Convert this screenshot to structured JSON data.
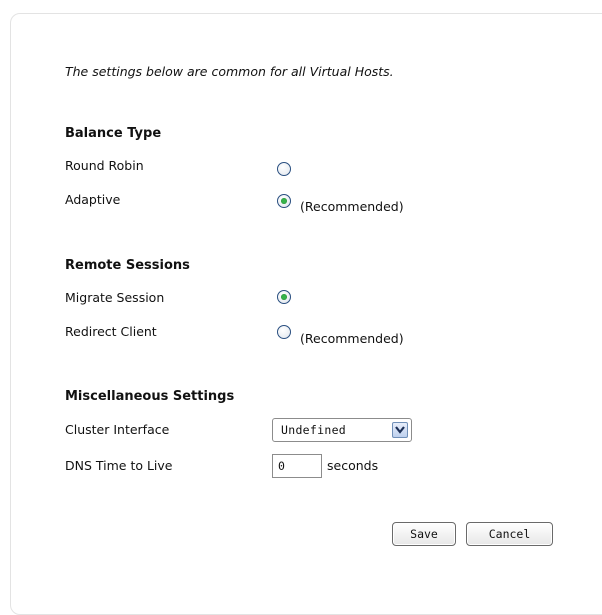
{
  "intro": "The settings below are common for all Virtual Hosts.",
  "balance_type": {
    "title": "Balance Type",
    "options": [
      {
        "label": "Round Robin",
        "checked": false,
        "note": ""
      },
      {
        "label": "Adaptive",
        "checked": true,
        "note": "(Recommended)"
      }
    ]
  },
  "remote_sessions": {
    "title": "Remote Sessions",
    "options": [
      {
        "label": "Migrate Session",
        "checked": true,
        "note": ""
      },
      {
        "label": "Redirect Client",
        "checked": false,
        "note": "(Recommended)"
      }
    ]
  },
  "misc": {
    "title": "Miscellaneous Settings",
    "cluster_interface_label": "Cluster Interface",
    "cluster_interface_value": "Undefined",
    "dns_ttl_label": "DNS Time to Live",
    "dns_ttl_value": "0",
    "dns_ttl_unit": "seconds"
  },
  "buttons": {
    "save": "Save",
    "cancel": "Cancel"
  }
}
